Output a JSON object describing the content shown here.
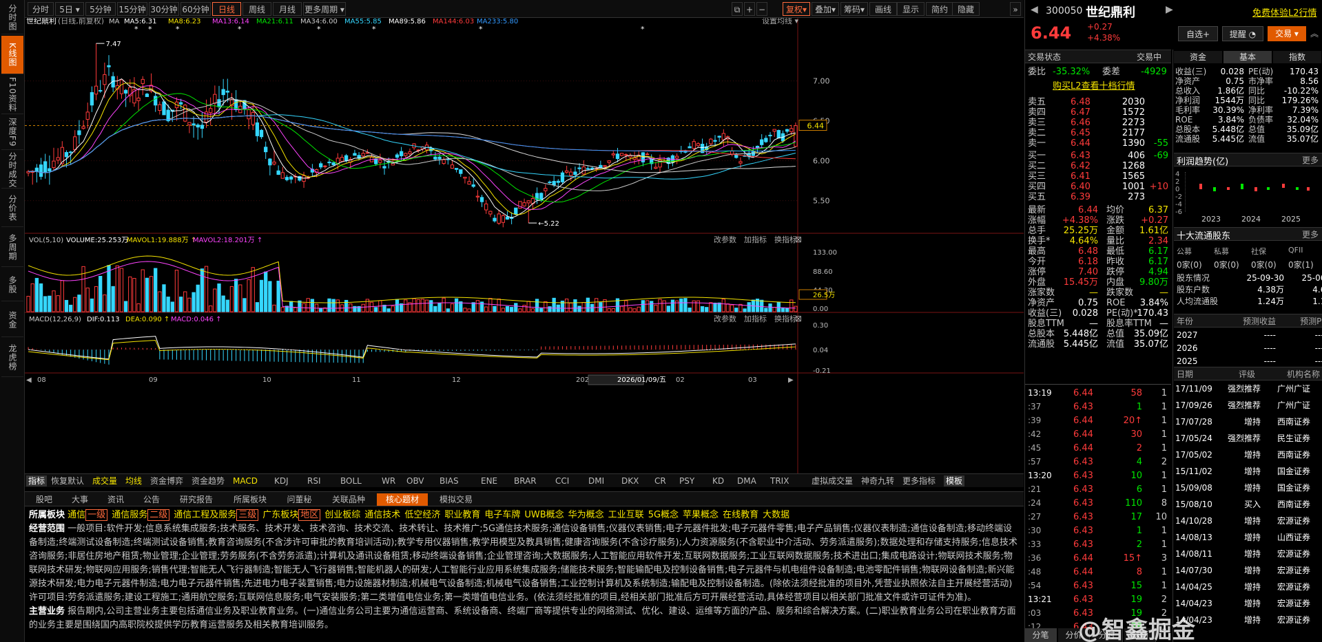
{
  "sidebar": [
    "分时图",
    "K线图",
    "F10资料",
    "深度F9",
    "分时成交",
    "分价表",
    "多周期",
    "多股",
    "资金",
    "龙虎榜"
  ],
  "toolbar": {
    "periods": [
      "分时",
      "5日",
      "5分钟",
      "15分钟",
      "30分钟",
      "60分钟",
      "日线",
      "周线",
      "月线",
      "更多周期"
    ],
    "active": "日线",
    "tools": [
      "复权",
      "叠加",
      "筹码",
      "画线",
      "显示",
      "简约",
      "隐藏"
    ]
  },
  "chart": {
    "name": "世纪鼎利",
    "period": "(日线,前复权)",
    "ma": [
      "MA",
      "MA5:6.31",
      "MA8:6.23",
      "MA13:6.14",
      "MA21:6.11",
      "MA34:6.00",
      "MA55:5.85",
      "MA89:5.86",
      "MA144:6.03",
      "MA233:5.80"
    ],
    "ma_colors": [
      "#cccccc",
      "#ffffff",
      "#f5e400",
      "#ff44ff",
      "#00e600",
      "#cccccc",
      "#35d7ff",
      "#ffffff",
      "#ff3b3b",
      "#3399ff"
    ],
    "settings": "设置均线",
    "current": "6.44",
    "high": "7.47",
    "low": "5.22",
    "yticks": [
      "7.00",
      "6.50",
      "6.00",
      "5.50"
    ],
    "vol_title": "VOL(5,10)",
    "vol": [
      "VOLUME:25.253万",
      "MAVOL1:19.888万",
      "MAVOL2:18.201万"
    ],
    "vol_ticks": [
      "133.00",
      "88.60",
      "44.30",
      "0.00"
    ],
    "vol_cur": "26.5万",
    "macd_title": "MACD(12,26,9)",
    "macd": [
      "DIF:0.113",
      "DEA:0.090",
      "MACD:0.046"
    ],
    "macd_ticks": [
      "0.30",
      "0.04",
      "-0.21"
    ],
    "panel_btns": [
      "改参数",
      "加指标",
      "换指标"
    ],
    "xaxis": [
      "08",
      "09",
      "10",
      "11",
      "12",
      "2026",
      "2026/01/09/五",
      "02",
      "03"
    ]
  },
  "chart_data": {
    "type": "candlestick",
    "ylim": [
      5.1,
      7.6
    ],
    "high": 7.47,
    "low": 5.22,
    "last": 6.44
  },
  "indicators": [
    "指标",
    "恢复默认",
    "成交量",
    "均线",
    "资金博弈",
    "资金趋势",
    "MACD",
    "KDJ",
    "RSI",
    "BOLL",
    "WR",
    "OBV",
    "BIAS",
    "ENE",
    "BRAR",
    "CCI",
    "DMI",
    "DKX",
    "CR",
    "PSY",
    "KD",
    "DMA",
    "TRIX",
    "虚拟成交量",
    "神奇九转",
    "更多指标",
    "模板"
  ],
  "f10": {
    "tabs": [
      "股吧",
      "大事",
      "资讯",
      "公告",
      "研究报告",
      "所属板块",
      "问董秘",
      "关联品种",
      "核心题材",
      "模拟交易"
    ],
    "active": "核心题材",
    "sector_label": "所属板块",
    "sectors": [
      [
        "通信",
        "一级"
      ],
      [
        "通信服务",
        "二级"
      ],
      [
        "通信工程及服务",
        "三级"
      ],
      [
        "广东板块",
        "地区"
      ],
      [
        "创业板综",
        ""
      ],
      [
        "通信技术",
        ""
      ],
      [
        "低空经济",
        ""
      ],
      [
        "职业教育",
        ""
      ],
      [
        "电子车牌",
        ""
      ],
      [
        "UWB概念",
        ""
      ],
      [
        "华为概念",
        ""
      ],
      [
        "工业互联",
        ""
      ],
      [
        "5G概念",
        ""
      ],
      [
        "苹果概念",
        ""
      ],
      [
        "在线教育",
        ""
      ],
      [
        "大数据",
        ""
      ]
    ],
    "scope_label": "经营范围",
    "scope": "一般项目:软件开发;信息系统集成服务;技术服务、技术开发、技术咨询、技术交流、技术转让、技术推广;5G通信技术服务;通信设备销售;仪器仪表销售;电子元器件批发;电子元器件零售;电子产品销售;仪器仪表制造;通信设备制造;移动终端设备制造;终端测试设备制造;终端测试设备销售;教育咨询服务(不含涉许可审批的教育培训活动);教学专用仪器销售;教学用模型及教具销售;健康咨询服务(不含诊疗服务);人力资源服务(不含职业中介活动、劳务派遣服务);数据处理和存储支持服务;信息技术咨询服务;非居住房地产租赁;物业管理;企业管理;劳务服务(不含劳务派遣);计算机及通讯设备租赁;移动终端设备销售;企业管理咨询;大数据服务;人工智能应用软件开发;互联网数据服务;工业互联网数据服务;技术进出口;集成电路设计;物联网技术服务;物联网技术研发;物联网应用服务;销售代理;智能无人飞行器制造;智能无人飞行器销售;智能机器人的研发;人工智能行业应用系统集成服务;储能技术服务;智能输配电及控制设备销售;电子元器件与机电组件设备制造;电池零配件销售;物联网设备制造;新兴能源技术研发;电力电子元器件制造;电力电子元器件销售;先进电力电子装置销售;电力设施器材制造;机械电气设备制造;机械电气设备销售;工业控制计算机及系统制造;输配电及控制设备制造。(除依法须经批准的项目外,凭营业执照依法自主开展经营活动)许可项目:劳务派遣服务;建设工程施工;通用航空服务;互联网信息服务;电气安装服务;第二类增值电信业务;第一类增值电信业务。(依法须经批准的项目,经相关部门批准后方可开展经营活动,具体经营项目以相关部门批准文件或许可证件为准)。",
    "main_label": "主营业务",
    "main": "报告期内,公司主营业务主要包括通信业务及职业教育业务。(一)通信业务公司主要为通信运营商、系统设备商、终端厂商等提供专业的网络测试、优化、建设、运维等方面的产品、服务和综合解决方案。(二)职业教育业务公司在职业教育方面的业务主要是围绕国内高职院校提供学历教育运营服务及相关教育培训服务。"
  },
  "quote": {
    "code": "300050",
    "name": "世纪鼎利",
    "trial": "免费体验L2行情",
    "price": "6.44",
    "chg": "+0.27",
    "pct": "+4.38%",
    "btns": [
      "自选+",
      "提醒",
      "交易"
    ],
    "status_label": "交易状态",
    "status": "交易中",
    "weibi_label": "委比",
    "weibi": "-35.32%",
    "weicha_label": "委差",
    "weicha": "-4929",
    "l2": "购买L2查看十档行情",
    "sell": [
      [
        "卖五",
        "6.48",
        "2030",
        ""
      ],
      [
        "卖四",
        "6.47",
        "1572",
        ""
      ],
      [
        "卖三",
        "6.46",
        "2273",
        ""
      ],
      [
        "卖二",
        "6.45",
        "2177",
        ""
      ],
      [
        "卖一",
        "6.44",
        "1390",
        "-55"
      ]
    ],
    "buy": [
      [
        "买一",
        "6.43",
        "406",
        "-69"
      ],
      [
        "买二",
        "6.42",
        "1268",
        ""
      ],
      [
        "买三",
        "6.41",
        "1565",
        ""
      ],
      [
        "买四",
        "6.40",
        "1001",
        "+10"
      ],
      [
        "买五",
        "6.39",
        "273",
        ""
      ]
    ],
    "stats": [
      [
        "最新",
        "6.44",
        "均价",
        "6.37"
      ],
      [
        "涨幅",
        "+4.38%",
        "涨跌",
        "+0.27"
      ],
      [
        "总手",
        "25.25万",
        "金额",
        "1.61亿"
      ],
      [
        "换手*",
        "4.64%",
        "量比",
        "2.34"
      ],
      [
        "最高",
        "6.48",
        "最低",
        "6.17"
      ],
      [
        "今开",
        "6.18",
        "昨收",
        "6.17"
      ],
      [
        "涨停",
        "7.40",
        "跌停",
        "4.94"
      ],
      [
        "外盘",
        "15.45万",
        "内盘",
        "9.80万"
      ],
      [
        "涨家数",
        "—",
        "跌家数",
        "—"
      ],
      [
        "净资产",
        "0.75",
        "ROE",
        "3.84%"
      ],
      [
        "收益(三)",
        "0.028",
        "PE(动)*",
        "170.43"
      ],
      [
        "股息TTM",
        "—",
        "股息率TTM",
        "—"
      ],
      [
        "总股本",
        "5.448亿",
        "总值",
        "35.09亿"
      ],
      [
        "流通股",
        "5.445亿",
        "流值",
        "35.07亿"
      ]
    ],
    "ticks": [
      [
        "13:19",
        "6.44",
        "58",
        "1"
      ],
      [
        ":37",
        "6.43",
        "1",
        "1"
      ],
      [
        ":39",
        "6.44",
        "20",
        "1"
      ],
      [
        ":42",
        "6.44",
        "30",
        "1"
      ],
      [
        ":45",
        "6.44",
        "2",
        "1"
      ],
      [
        ":57",
        "6.43",
        "4",
        "2"
      ],
      [
        "13:20",
        "6.43",
        "10",
        "1"
      ],
      [
        ":21",
        "6.43",
        "6",
        "1"
      ],
      [
        ":24",
        "6.43",
        "110",
        "8"
      ],
      [
        ":27",
        "6.43",
        "17",
        "10"
      ],
      [
        ":30",
        "6.43",
        "1",
        "1"
      ],
      [
        ":33",
        "6.43",
        "2",
        "1"
      ],
      [
        ":36",
        "6.44",
        "15",
        "3"
      ],
      [
        ":48",
        "6.44",
        "8",
        "1"
      ],
      [
        ":54",
        "6.43",
        "15",
        "1"
      ],
      [
        "13:21",
        "6.43",
        "19",
        "2"
      ],
      [
        ":03",
        "6.43",
        "19",
        "2"
      ],
      [
        ":12",
        "6.43",
        "78",
        "1"
      ]
    ],
    "bottom_tabs": [
      "分笔",
      "分价",
      "分时",
      "异动"
    ]
  },
  "fund": {
    "tabs": [
      "资金",
      "基本",
      "指数"
    ],
    "active": "基本",
    "rows": [
      [
        "收益(三)",
        "0.028",
        "PE(动)",
        "170.43"
      ],
      [
        "净资产",
        "0.75",
        "市净率",
        "8.56"
      ],
      [
        "总收入",
        "1.86亿",
        "同比",
        "-10.22%"
      ],
      [
        "净利润",
        "1544万",
        "同比",
        "179.26%"
      ],
      [
        "毛利率",
        "30.39%",
        "净利率",
        "7.39%"
      ],
      [
        "ROE",
        "3.84%",
        "负债率",
        "32.04%"
      ],
      [
        "总股本",
        "5.448亿",
        "总值",
        "35.09亿"
      ],
      [
        "流通股",
        "5.445亿",
        "流值",
        "35.07亿"
      ]
    ],
    "profit_title": "利润趋势(亿)",
    "more": "更多",
    "profit_years": [
      "2023",
      "2024",
      "2025"
    ],
    "profit_ticks": [
      "4",
      "2",
      "0",
      "-2",
      "-4",
      "-6"
    ],
    "holders_title": "十大流通股东",
    "holders_head": [
      "公募",
      "私募",
      "社保",
      "QFII"
    ],
    "holders_vals": [
      "0家(0)",
      "0家(0)",
      "0家(0)",
      "0家(1)"
    ],
    "hold_rows": [
      [
        "股东情况",
        "25-09-30",
        "25-06-30"
      ],
      [
        "股东户数",
        "4.38万",
        "4.68万"
      ],
      [
        "人均流通股",
        "1.24万",
        "1.16万"
      ]
    ],
    "fc_head": [
      "年份",
      "预测收益",
      "预测PE"
    ],
    "fc_rows": [
      [
        "2027",
        "----",
        "----"
      ],
      [
        "2026",
        "----",
        "----"
      ],
      [
        "2025",
        "----",
        "----"
      ]
    ],
    "rt_head": [
      "日期",
      "评级",
      "机构名称"
    ],
    "ratings": [
      [
        "17/11/09",
        "强烈推荐",
        "广州广证"
      ],
      [
        "17/09/26",
        "强烈推荐",
        "广州广证"
      ],
      [
        "17/07/28",
        "增持",
        "西南证券"
      ],
      [
        "17/05/24",
        "强烈推荐",
        "民生证券"
      ],
      [
        "17/05/02",
        "增持",
        "西南证券"
      ],
      [
        "15/11/02",
        "增持",
        "国金证券"
      ],
      [
        "15/09/08",
        "增持",
        "国金证券"
      ],
      [
        "15/08/10",
        "买入",
        "西南证券"
      ],
      [
        "14/10/28",
        "增持",
        "宏源证券"
      ],
      [
        "14/08/13",
        "增持",
        "山西证券"
      ],
      [
        "14/08/11",
        "增持",
        "宏源证券"
      ],
      [
        "14/07/30",
        "增持",
        "宏源证券"
      ],
      [
        "14/04/25",
        "增持",
        "宏源证券"
      ],
      [
        "14/04/23",
        "增持",
        "宏源证券"
      ],
      [
        "14/04/23",
        "增持",
        "宏源证券"
      ]
    ]
  },
  "watermark": "@智鑫掘金"
}
